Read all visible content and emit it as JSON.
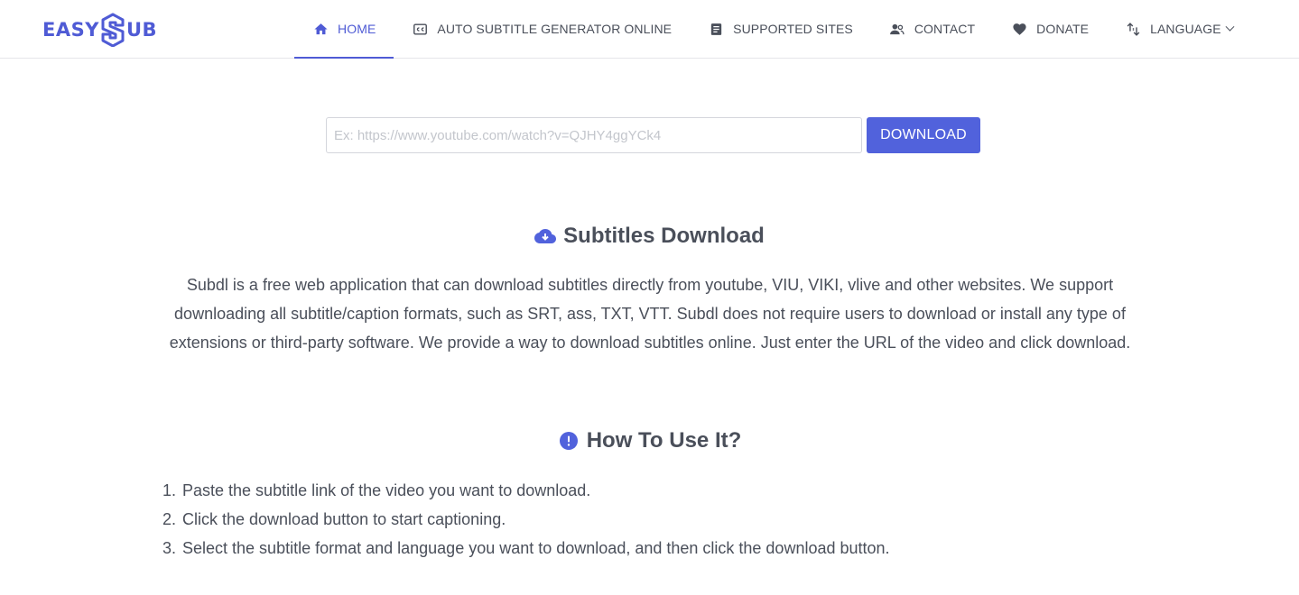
{
  "logo": {
    "text_left": "EASY",
    "text_right": "UB"
  },
  "nav": {
    "items": [
      {
        "label": "HOME",
        "icon": "home-icon"
      },
      {
        "label": "AUTO SUBTITLE GENERATOR ONLINE",
        "icon": "closed-caption-icon"
      },
      {
        "label": "SUPPORTED SITES",
        "icon": "document-icon"
      },
      {
        "label": "CONTACT",
        "icon": "contact-icon"
      },
      {
        "label": "DONATE",
        "icon": "heart-icon"
      },
      {
        "label": "LANGUAGE",
        "icon": "translate-icon"
      }
    ]
  },
  "search": {
    "placeholder": "Ex: https://www.youtube.com/watch?v=QJHY4ggYCk4",
    "value": "",
    "button_label": "DOWNLOAD"
  },
  "about": {
    "title": "Subtitles Download",
    "icon": "cloud-download-icon",
    "text": "Subdl is a free web application that can download subtitles directly from youtube, VIU, VIKI, vlive and other websites. We support downloading all subtitle/caption formats, such as SRT, ass, TXT, VTT. Subdl does not require users to download or install any type of extensions or third-party software. We provide a way to download subtitles online. Just enter the URL of the video and click download."
  },
  "howto": {
    "title": "How To Use It?",
    "icon": "info-icon",
    "steps": [
      {
        "num": "1.",
        "text": "Paste the subtitle link of the video you want to download."
      },
      {
        "num": "2.",
        "text": "Click the download button to start captioning."
      },
      {
        "num": "3.",
        "text": "Select the subtitle format and language you want to download, and then click the download button."
      }
    ]
  },
  "colors": {
    "accent": "#5162dc",
    "text": "#4a4f5a",
    "border": "#e6e6ea"
  }
}
